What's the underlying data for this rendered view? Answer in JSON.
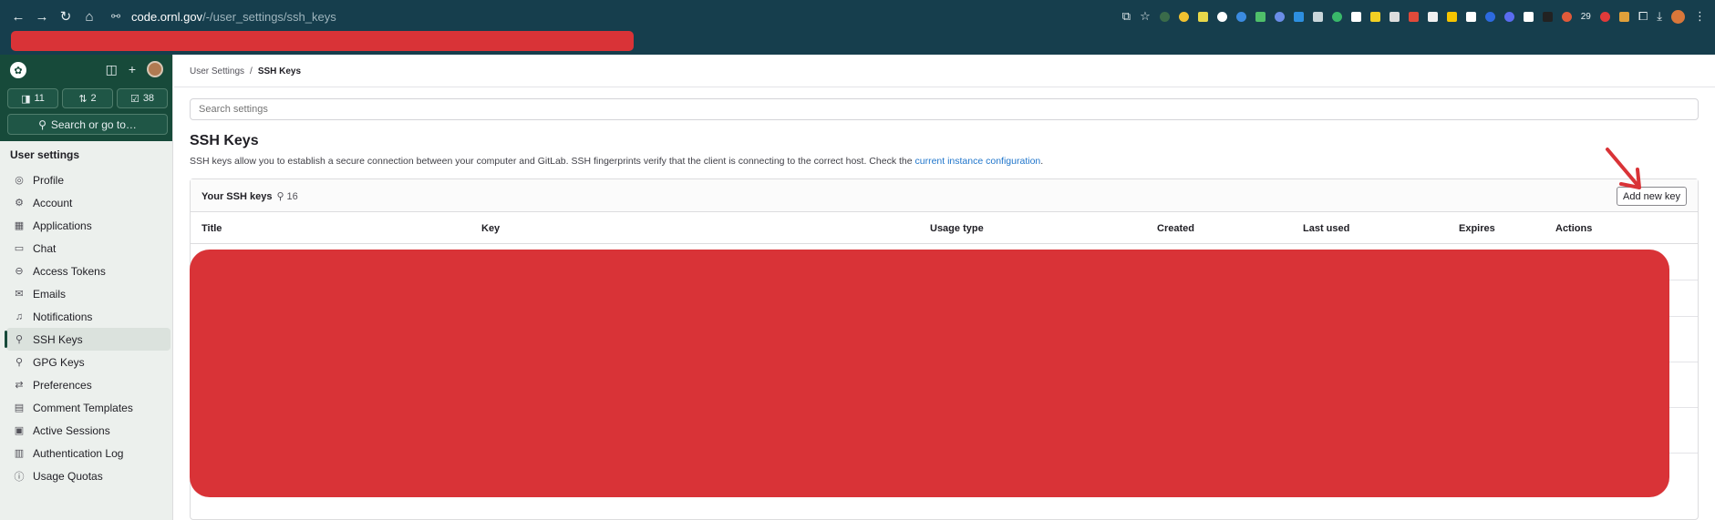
{
  "browser": {
    "url_domain": "code.ornl.gov",
    "url_path": "/-/user_settings/ssh_keys",
    "nav_icons": [
      "back-icon",
      "forward-icon",
      "reload-icon",
      "home-icon"
    ],
    "extension_badge": "29"
  },
  "sidebar": {
    "title": "User settings",
    "counts": [
      {
        "icon": "issues-icon",
        "value": "11"
      },
      {
        "icon": "merge-request-icon",
        "value": "2"
      },
      {
        "icon": "todo-icon",
        "value": "38"
      }
    ],
    "search_label": "Search or go to…",
    "items": [
      {
        "label": "Profile",
        "icon": "profile-icon",
        "glyph": "◎"
      },
      {
        "label": "Account",
        "icon": "account-icon",
        "glyph": "⚙"
      },
      {
        "label": "Applications",
        "icon": "applications-icon",
        "glyph": "▦"
      },
      {
        "label": "Chat",
        "icon": "chat-icon",
        "glyph": "▭"
      },
      {
        "label": "Access Tokens",
        "icon": "token-icon",
        "glyph": "⊖"
      },
      {
        "label": "Emails",
        "icon": "email-icon",
        "glyph": "✉"
      },
      {
        "label": "Notifications",
        "icon": "bell-icon",
        "glyph": "♫"
      },
      {
        "label": "SSH Keys",
        "icon": "key-icon",
        "glyph": "⚲",
        "active": true
      },
      {
        "label": "GPG Keys",
        "icon": "key-icon",
        "glyph": "⚲"
      },
      {
        "label": "Preferences",
        "icon": "preferences-icon",
        "glyph": "⇄"
      },
      {
        "label": "Comment Templates",
        "icon": "comment-icon",
        "glyph": "▤"
      },
      {
        "label": "Active Sessions",
        "icon": "monitor-icon",
        "glyph": "▣"
      },
      {
        "label": "Authentication Log",
        "icon": "log-icon",
        "glyph": "▥"
      },
      {
        "label": "Usage Quotas",
        "icon": "info-icon",
        "glyph": "ⓘ"
      }
    ]
  },
  "breadcrumb": {
    "parent": "User Settings",
    "separator": "/",
    "current": "SSH Keys"
  },
  "search_settings": {
    "placeholder": "Search settings"
  },
  "page": {
    "title": "SSH Keys",
    "description": "SSH keys allow you to establish a secure connection between your computer and GitLab. SSH fingerprints verify that the client is connecting to the correct host. Check the ",
    "description_link": "current instance configuration",
    "description_end": "."
  },
  "card": {
    "title": "Your SSH keys",
    "count": "16",
    "add_button": "Add new key"
  },
  "table": {
    "columns": [
      "Title",
      "Key",
      "Usage type",
      "Created",
      "Last used",
      "Expires",
      "Actions"
    ]
  },
  "colors": {
    "chrome": "#163e4d",
    "sidebar_header": "#174a3a",
    "redaction": "#d93337",
    "link": "#1f75cb",
    "annotation_arrow": "#d93337"
  }
}
